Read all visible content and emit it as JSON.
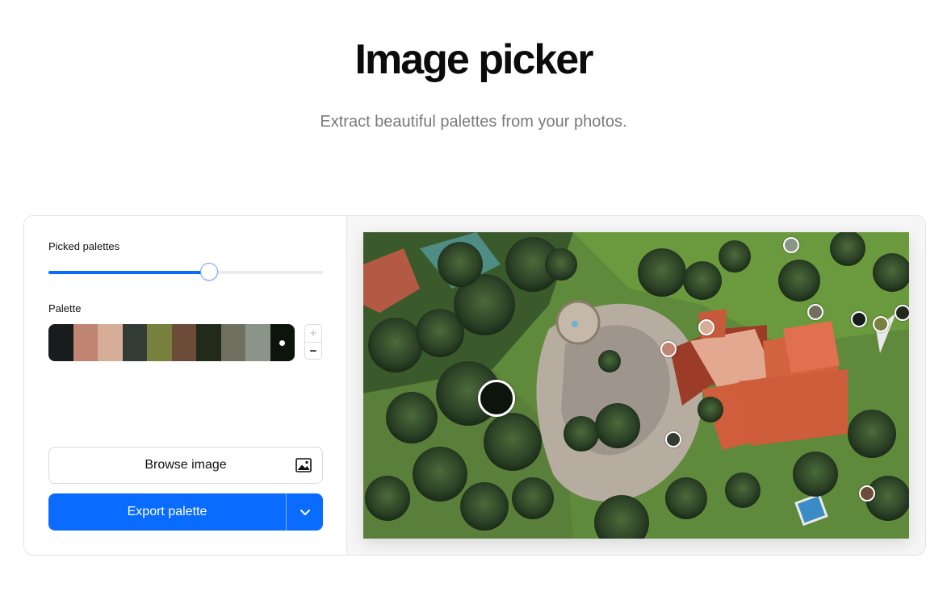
{
  "header": {
    "title": "Image picker",
    "subtitle": "Extract beautiful palettes from your photos."
  },
  "controls": {
    "picked_label": "Picked palettes",
    "slider_fraction": 0.585,
    "palette_label": "Palette",
    "swatches": [
      "#181c1c",
      "#c08472",
      "#d6ae98",
      "#323c34",
      "#78803e",
      "#6c4c38",
      "#222a1c",
      "#707060",
      "#8a9488",
      "#0c140c"
    ],
    "selected_swatch": 9,
    "stepper": {
      "plus": "+",
      "minus": "−"
    },
    "browse_label": "Browse image",
    "export_label": "Export palette"
  },
  "colors": {
    "accent": "#0a6cff"
  },
  "image": {
    "pickers": [
      {
        "color": "#0c140c",
        "selected": true
      },
      {
        "color": "#8a9488"
      },
      {
        "color": "#d6ae98"
      },
      {
        "color": "#c08472"
      },
      {
        "color": "#707060"
      },
      {
        "color": "#181c1c"
      },
      {
        "color": "#78803e"
      },
      {
        "color": "#222a1c"
      },
      {
        "color": "#323c34"
      },
      {
        "color": "#6c4c38"
      }
    ]
  }
}
